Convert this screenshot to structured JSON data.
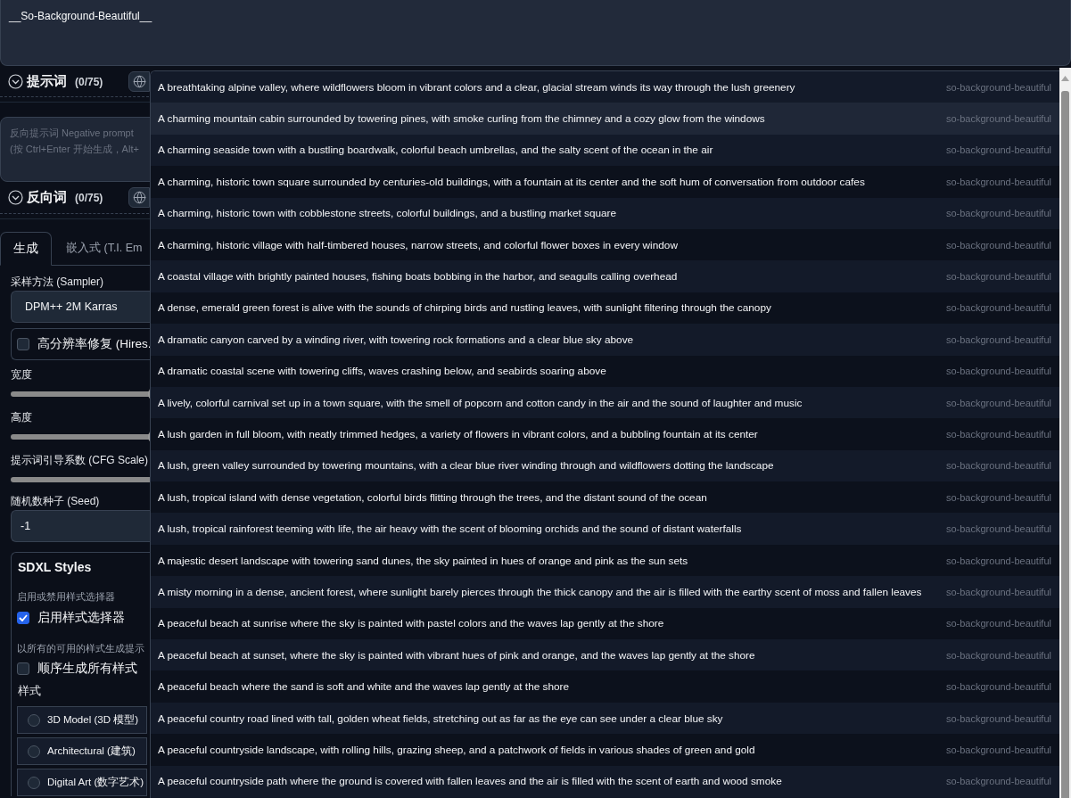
{
  "prompt": {
    "value": "__So-Background-Beautiful__"
  },
  "prompt_header": {
    "label": "提示词",
    "count": "(0/75)"
  },
  "negative_prompt": {
    "placeholder": "反向提示词 Negative prompt\n(按 Ctrl+Enter 开始生成，Alt+"
  },
  "negative_header": {
    "label": "反向词",
    "count": "(0/75)"
  },
  "tabs": [
    {
      "label": "生成",
      "selected": true
    },
    {
      "label": "嵌入式 (T.I. Em",
      "selected": false
    }
  ],
  "sampler": {
    "label": "采样方法 (Sampler)",
    "value": "DPM++ 2M Karras"
  },
  "hires_fix": {
    "label": "高分辨率修复 (Hires.",
    "checked": false
  },
  "sliders": [
    {
      "label": "宽度",
      "level": 0.29
    },
    {
      "label": "高度",
      "level": 0.29
    },
    {
      "label": "提示词引导系数 (CFG Scale)"
    }
  ],
  "seed": {
    "label": "随机数种子 (Seed)",
    "value": "-1"
  },
  "sdxl_styles": {
    "title": "SDXL Styles",
    "enable_hint": "启用或禁用样式选择器",
    "enable": {
      "label": "启用样式选择器",
      "checked": true
    },
    "all_hint": "以所有的可用的样式生成提示",
    "all": {
      "label": "顺序生成所有样式",
      "checked": false
    },
    "styles_label": "样式",
    "styles": [
      {
        "label": "3D Model (3D 模型)",
        "selected": false
      },
      {
        "label": "Architectural (建筑)",
        "selected": false
      },
      {
        "label": "Digital Art (数字艺术)",
        "selected": false
      }
    ]
  },
  "autocomplete": {
    "options": [
      {
        "text": "A breathtaking alpine valley, where wildflowers bloom in vibrant colors and a clear, glacial stream winds its way through the lush greenery",
        "tag": "so-background-beautiful",
        "selected": false
      },
      {
        "text": "A charming mountain cabin surrounded by towering pines, with smoke curling from the chimney and a cozy glow from the windows",
        "tag": "so-background-beautiful",
        "selected": true
      },
      {
        "text": "A charming seaside town with a bustling boardwalk, colorful beach umbrellas, and the salty scent of the ocean in the air",
        "tag": "so-background-beautiful",
        "selected": false
      },
      {
        "text": "A charming, historic town square surrounded by centuries-old buildings, with a fountain at its center and the soft hum of conversation from outdoor cafes",
        "tag": "so-background-beautiful",
        "selected": false
      },
      {
        "text": "A charming, historic town with cobblestone streets, colorful buildings, and a bustling market square",
        "tag": "so-background-beautiful",
        "selected": false
      },
      {
        "text": "A charming, historic village with half-timbered houses, narrow streets, and colorful flower boxes in every window",
        "tag": "so-background-beautiful",
        "selected": false
      },
      {
        "text": "A coastal village with brightly painted houses, fishing boats bobbing in the harbor, and seagulls calling overhead",
        "tag": "so-background-beautiful",
        "selected": false
      },
      {
        "text": "A dense, emerald green forest is alive with the sounds of chirping birds and rustling leaves, with sunlight filtering through the canopy",
        "tag": "so-background-beautiful",
        "selected": false
      },
      {
        "text": "A dramatic canyon carved by a winding river, with towering rock formations and a clear blue sky above",
        "tag": "so-background-beautiful",
        "selected": false
      },
      {
        "text": "A dramatic coastal scene with towering cliffs, waves crashing below, and seabirds soaring above",
        "tag": "so-background-beautiful",
        "selected": false
      },
      {
        "text": "A lively, colorful carnival set up in a town square, with the smell of popcorn and cotton candy in the air and the sound of laughter and music",
        "tag": "so-background-beautiful",
        "selected": false
      },
      {
        "text": "A lush garden in full bloom, with neatly trimmed hedges, a variety of flowers in vibrant colors, and a bubbling fountain at its center",
        "tag": "so-background-beautiful",
        "selected": false
      },
      {
        "text": "A lush, green valley surrounded by towering mountains, with a clear blue river winding through and wildflowers dotting the landscape",
        "tag": "so-background-beautiful",
        "selected": false
      },
      {
        "text": "A lush, tropical island with dense vegetation, colorful birds flitting through the trees, and the distant sound of the ocean",
        "tag": "so-background-beautiful",
        "selected": false
      },
      {
        "text": "A lush, tropical rainforest teeming with life, the air heavy with the scent of blooming orchids and the sound of distant waterfalls",
        "tag": "so-background-beautiful",
        "selected": false
      },
      {
        "text": "A majestic desert landscape with towering sand dunes, the sky painted in hues of orange and pink as the sun sets",
        "tag": "so-background-beautiful",
        "selected": false
      },
      {
        "text": "A misty morning in a dense, ancient forest, where sunlight barely pierces through the thick canopy and the air is filled with the earthy scent of moss and fallen leaves",
        "tag": "so-background-beautiful",
        "selected": false
      },
      {
        "text": "A peaceful beach at sunrise where the sky is painted with pastel colors and the waves lap gently at the shore",
        "tag": "so-background-beautiful",
        "selected": false
      },
      {
        "text": "A peaceful beach at sunset, where the sky is painted with vibrant hues of pink and orange, and the waves lap gently at the shore",
        "tag": "so-background-beautiful",
        "selected": false
      },
      {
        "text": "A peaceful beach where the sand is soft and white and the waves lap gently at the shore",
        "tag": "so-background-beautiful",
        "selected": false
      },
      {
        "text": "A peaceful country road lined with tall, golden wheat fields, stretching out as far as the eye can see under a clear blue sky",
        "tag": "so-background-beautiful",
        "selected": false
      },
      {
        "text": "A peaceful countryside landscape, with rolling hills, grazing sheep, and a patchwork of fields in various shades of green and gold",
        "tag": "so-background-beautiful",
        "selected": false
      },
      {
        "text": "A peaceful countryside path where the ground is covered with fallen leaves and the air is filled with the scent of earth and wood smoke",
        "tag": "so-background-beautiful",
        "selected": false
      }
    ]
  }
}
